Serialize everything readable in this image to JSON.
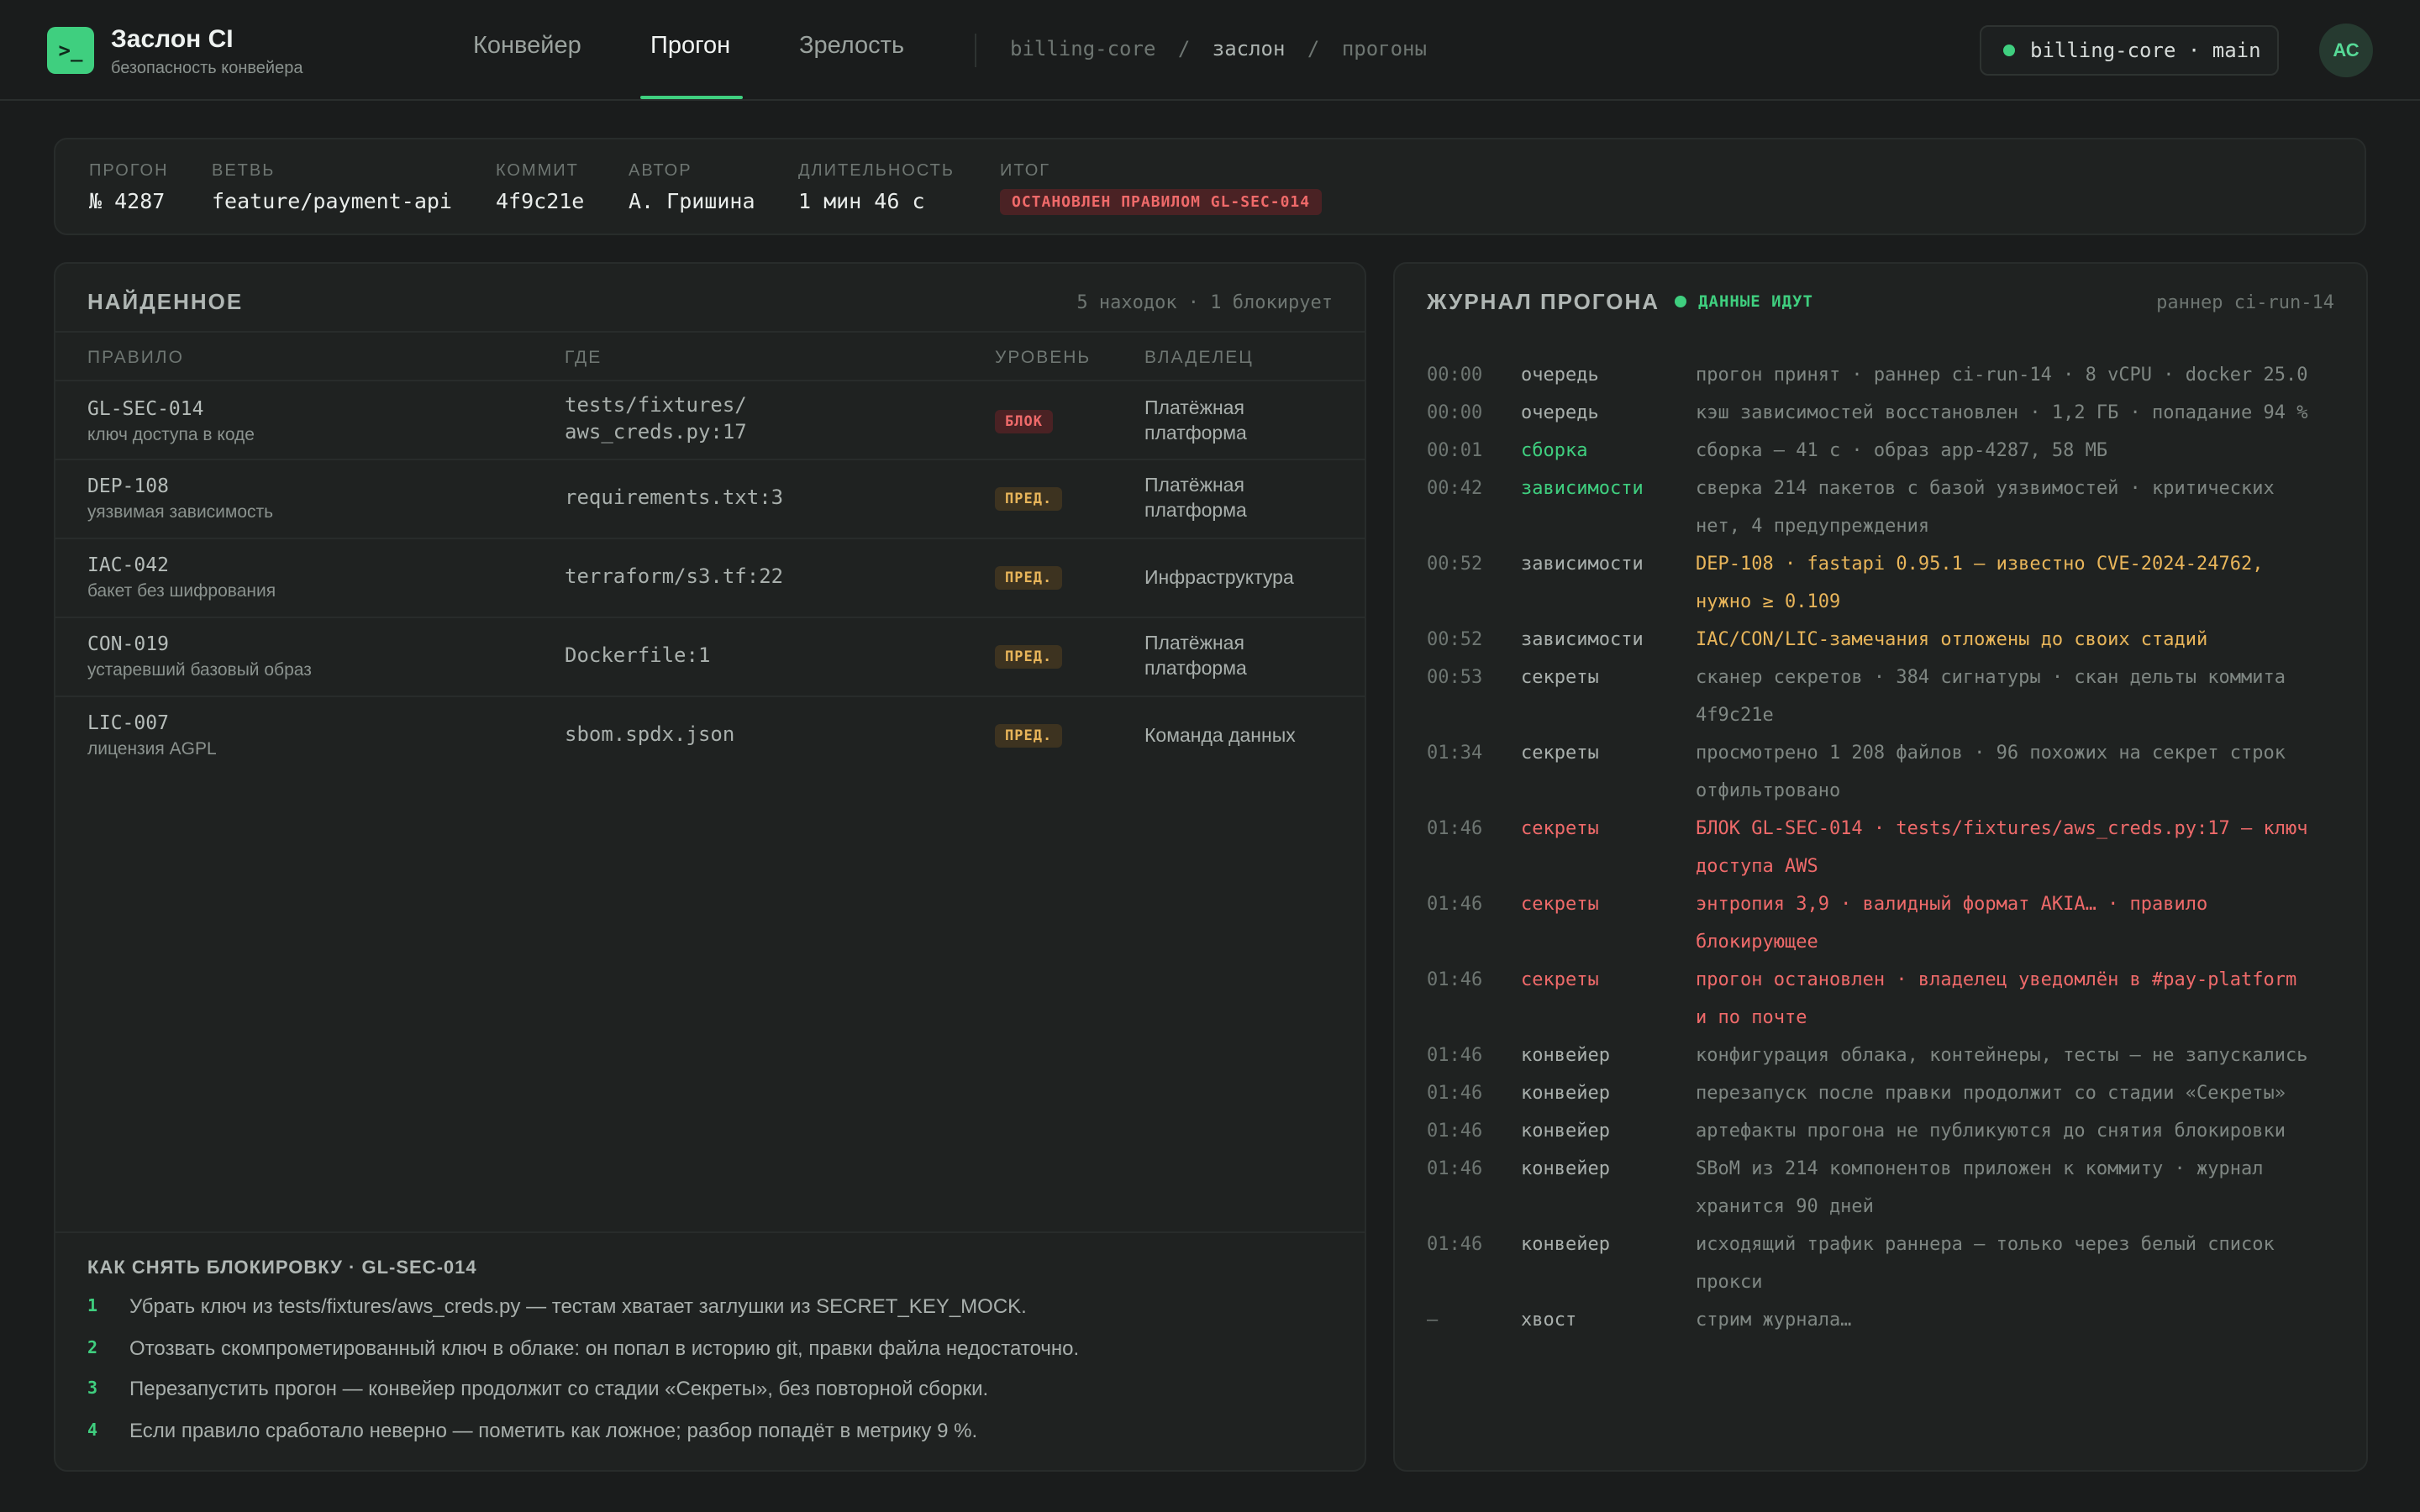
{
  "app": {
    "logo_glyph": ">_",
    "title": "Заслон CI",
    "subtitle": "безопасность конвейера"
  },
  "nav": {
    "tabs": [
      {
        "label": "Конвейер",
        "active": false
      },
      {
        "label": "Прогон",
        "active": true
      },
      {
        "label": "Зрелость",
        "active": false
      }
    ]
  },
  "breadcrumb": {
    "parts": [
      "billing-core",
      "заслон",
      "прогоны"
    ],
    "separator": "/"
  },
  "repo": {
    "label": "billing-core · main",
    "status_color": "#3fcf7f"
  },
  "user": {
    "initials": "АС"
  },
  "summary": {
    "run_label": "ПРОГОН",
    "run_value": "№ 4287",
    "branch_label": "ВЕТВЬ",
    "branch_value": "feature/payment-api",
    "commit_label": "КОММИТ",
    "commit_value": "4f9c21e",
    "author_label": "АВТОР",
    "author_value": "А. Гришина",
    "duration_label": "ДЛИТЕЛЬНОСТЬ",
    "duration_value": "1 мин 46 с",
    "result_label": "ИТОГ",
    "result_value": "ОСТАНОВЛЕН ПРАВИЛОМ GL-SEC-014"
  },
  "findings": {
    "title": "НАЙДЕННОЕ",
    "meta": "5 находок · 1 блокирует",
    "columns": {
      "rule": "ПРАВИЛО",
      "where": "ГДЕ",
      "level": "УРОВЕНЬ",
      "owner": "ВЛАДЕЛЕЦ"
    },
    "rows": [
      {
        "id": "GL-SEC-014",
        "desc": "ключ доступа в коде",
        "where1": "tests/fixtures/",
        "where2": "aws_creds.py:17",
        "level": "БЛОК",
        "owner1": "Платёжная",
        "owner2": "платформа"
      },
      {
        "id": "DEP-108",
        "desc": "уязвимая зависимость",
        "where1": "requirements.txt:3",
        "where2": "",
        "level": "ПРЕД.",
        "owner1": "Платёжная",
        "owner2": "платформа"
      },
      {
        "id": "IAC-042",
        "desc": "бакет без шифрования",
        "where1": "terraform/s3.tf:22",
        "where2": "",
        "level": "ПРЕД.",
        "owner1": "Инфраструктура",
        "owner2": ""
      },
      {
        "id": "CON-019",
        "desc": "устаревший базовый образ",
        "where1": "Dockerfile:1",
        "where2": "",
        "level": "ПРЕД.",
        "owner1": "Платёжная",
        "owner2": "платформа"
      },
      {
        "id": "LIC-007",
        "desc": "лицензия AGPL",
        "where1": "sbom.spdx.json",
        "where2": "",
        "level": "ПРЕД.",
        "owner1": "Команда данных",
        "owner2": ""
      }
    ],
    "fix": {
      "title": "КАК СНЯТЬ БЛОКИРОВКУ · GL-SEC-014",
      "steps": [
        {
          "n": "1",
          "text": "Убрать ключ из tests/fixtures/aws_creds.py — тестам хватает заглушки из SECRET_KEY_MOCK."
        },
        {
          "n": "2",
          "text": "Отозвать скомпрометированный ключ в облаке: он попал в историю git, правки файла недостаточно."
        },
        {
          "n": "3",
          "text": "Перезапустить прогон — конвейер продолжит со стадии «Секреты», без повторной сборки."
        },
        {
          "n": "4",
          "text": "Если правило сработало неверно — пометить как ложное; разбор попадёт в метрику 9 %."
        }
      ]
    }
  },
  "log": {
    "title": "ЖУРНАЛ ПРОГОНА",
    "live_label": "ДАННЫЕ ИДУТ",
    "runner": "раннер ci-run-14",
    "rows": [
      {
        "t": "00:00",
        "s": "очередь",
        "m": "прогон принят · раннер ci-run-14 · 8 vCPU · docker 25.0",
        "m2": ""
      },
      {
        "t": "00:00",
        "s": "очередь",
        "m": "кэш зависимостей восстановлен · 1,2 ГБ · попадание 94 %",
        "m2": ""
      },
      {
        "t": "00:01",
        "s": "сборка",
        "m": "сборка — 41 с · образ app-4287, 58 МБ",
        "m2": ""
      },
      {
        "t": "00:42",
        "s": "зависимости",
        "m": "сверка 214 пакетов с базой уязвимостей · критических",
        "m2": "нет, 4 предупреждения"
      },
      {
        "t": "00:52",
        "s": "зависимости",
        "m": "DEP-108 · fastapi 0.95.1 — известно CVE-2024-24762,",
        "m2": "нужно ≥ 0.109"
      },
      {
        "t": "00:52",
        "s": "зависимости",
        "m": "IAC/CON/LIC-замечания отложены до своих стадий",
        "m2": ""
      },
      {
        "t": "00:53",
        "s": "секреты",
        "m": "сканер секретов · 384 сигнатуры · скан дельты коммита",
        "m2": "4f9c21e"
      },
      {
        "t": "01:34",
        "s": "секреты",
        "m": "просмотрено 1 208 файлов · 96 похожих на секрет строк",
        "m2": "отфильтровано"
      },
      {
        "t": "01:46",
        "s": "секреты",
        "m": "БЛОК GL-SEC-014 · tests/fixtures/aws_creds.py:17 — ключ",
        "m2": "доступа AWS"
      },
      {
        "t": "01:46",
        "s": "секреты",
        "m": "энтропия 3,9 · валидный формат AKIA… · правило",
        "m2": "блокирующее"
      },
      {
        "t": "01:46",
        "s": "секреты",
        "m": "прогон остановлен · владелец уведомлён в #pay-platform",
        "m2": "и по почте"
      },
      {
        "t": "01:46",
        "s": "конвейер",
        "m": "конфигурация облака, контейнеры, тесты — не запускались",
        "m2": ""
      },
      {
        "t": "01:46",
        "s": "конвейер",
        "m": "перезапуск после правки продолжит со стадии «Секреты»",
        "m2": ""
      },
      {
        "t": "01:46",
        "s": "конвейер",
        "m": "артефакты прогона не публикуются до снятия блокировки",
        "m2": ""
      },
      {
        "t": "01:46",
        "s": "конвейер",
        "m": "SBoM из 214 компонентов приложен к коммиту · журнал",
        "m2": "хранится 90 дней"
      },
      {
        "t": "01:46",
        "s": "конвейер",
        "m": "исходящий трафик раннера — только через белый список",
        "m2": "прокси"
      },
      {
        "t": "—",
        "s": "хвост",
        "m": "стрим журнала…",
        "m2": ""
      }
    ]
  },
  "colors": {
    "accent": "#3fcf7f",
    "block": "#ef6a6a",
    "warn": "#e8b55a",
    "background": "#1a1c1c"
  }
}
